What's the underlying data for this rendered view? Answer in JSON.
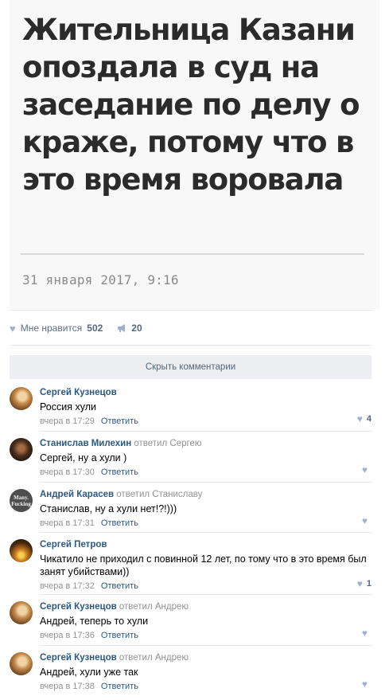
{
  "article": {
    "headline": "Жительница Казани опоздала в суд на заседание по делу о краже, потому что в это время воровала",
    "date": "31 января 2017, 9:16"
  },
  "actions": {
    "like_label": "Мне нравится",
    "like_count": "502",
    "share_count": "20"
  },
  "hide_comments": "Скрыть комментарии",
  "comments": [
    {
      "author": "Сергей Кузнецов",
      "reply_word": "",
      "reply_to": "",
      "text": "Россия хули",
      "time": "вчера в 17:29",
      "answer": "Ответить",
      "likes": "4"
    },
    {
      "author": "Станислав Милехин",
      "reply_word": "ответил",
      "reply_to": "Сергею",
      "text": "Сергей, ну а хули )",
      "time": "вчера в 17:30",
      "answer": "Ответить",
      "likes": ""
    },
    {
      "author": "Андрей Карасев",
      "reply_word": "ответил",
      "reply_to": "Станиславу",
      "text": "Станислав, ну а хули нет!?!)))",
      "time": "вчера в 17:31",
      "answer": "Ответить",
      "likes": "",
      "avatar_text": "Many. Fucking"
    },
    {
      "author": "Сергей Петров",
      "reply_word": "",
      "reply_to": "",
      "text": "Чикатило не приходил с повинной 12 лет, по тому что в это время был занят убийствами))",
      "time": "вчера в 17:32",
      "answer": "Ответить",
      "likes": "1"
    },
    {
      "author": "Сергей Кузнецов",
      "reply_word": "ответил",
      "reply_to": "Андрею",
      "text": "Андрей, теперь то хули",
      "time": "вчера в 17:36",
      "answer": "Ответить",
      "likes": ""
    },
    {
      "author": "Сергей Кузнецов",
      "reply_word": "ответил",
      "reply_to": "Андрею",
      "text": "Андрей, хули уже так",
      "time": "вчера в 17:38",
      "answer": "Ответить",
      "likes": ""
    }
  ]
}
